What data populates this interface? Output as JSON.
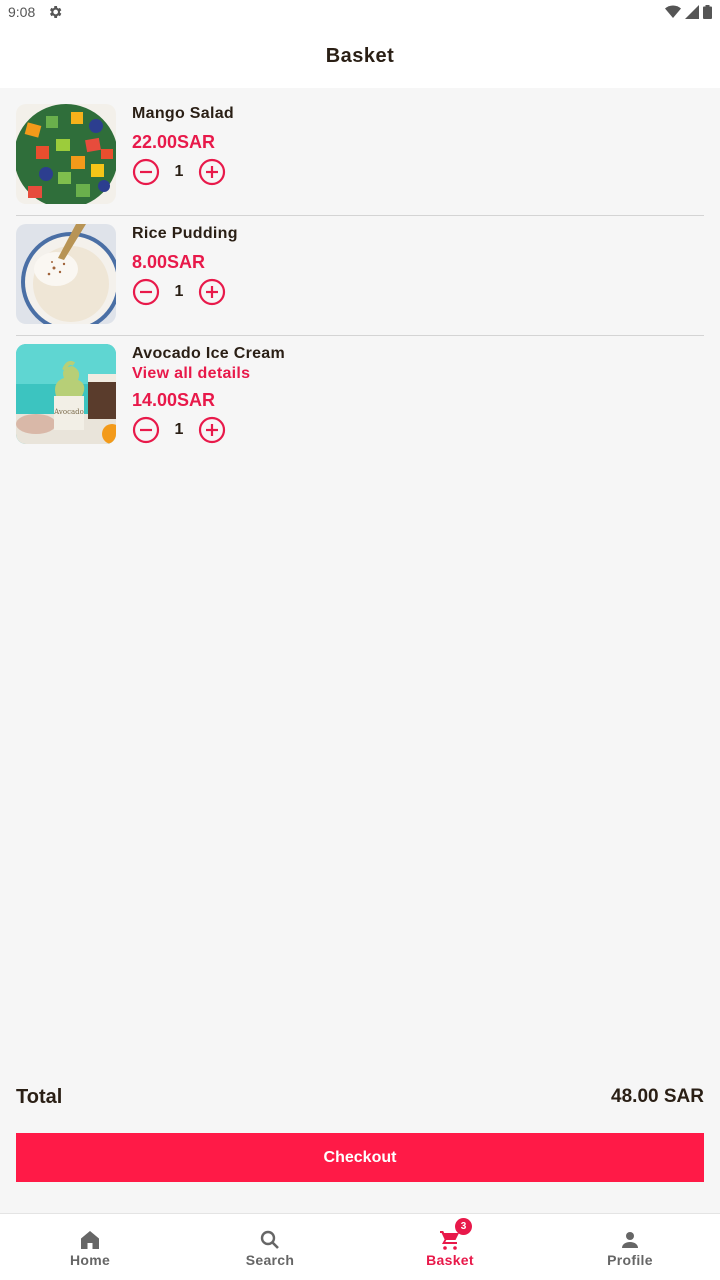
{
  "status_bar": {
    "time": "9:08",
    "icons": [
      "gear-icon",
      "wifi-icon",
      "signal-icon",
      "battery-icon"
    ]
  },
  "header": {
    "title": "Basket"
  },
  "items": [
    {
      "name": "Mango Salad",
      "price": "22.00SAR",
      "quantity": "1",
      "link": null,
      "image": "mango-salad-image"
    },
    {
      "name": "Rice Pudding",
      "price": "8.00SAR",
      "quantity": "1",
      "link": null,
      "image": "rice-pudding-image"
    },
    {
      "name": "Avocado Ice Cream",
      "price": "14.00SAR",
      "quantity": "1",
      "link": "View all details",
      "image": "avocado-ice-cream-image"
    }
  ],
  "summary": {
    "total_label": "Total",
    "total_value": "48.00 SAR"
  },
  "checkout_label": "Checkout",
  "nav": {
    "items": [
      {
        "label": "Home",
        "icon": "home-icon"
      },
      {
        "label": "Search",
        "icon": "search-icon"
      },
      {
        "label": "Basket",
        "icon": "cart-icon",
        "badge": "3",
        "active": true
      },
      {
        "label": "Profile",
        "icon": "person-icon"
      }
    ]
  },
  "colors": {
    "accent": "#e8194a",
    "button": "#ff1a47",
    "background": "#f6f6f6",
    "text": "#2a1f15"
  }
}
